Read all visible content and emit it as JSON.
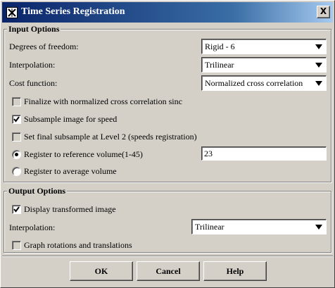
{
  "window": {
    "title": "Time Series Registration",
    "close_glyph": "X"
  },
  "input_options": {
    "title": "Input Options",
    "dof": {
      "label": "Degrees of freedom:",
      "value": "Rigid - 6"
    },
    "interpolation": {
      "label": "Interpolation:",
      "value": "Trilinear"
    },
    "cost": {
      "label": "Cost function:",
      "value": "Normalized cross correlation"
    },
    "finalize": {
      "label": "Finalize with normalized cross correlation sinc",
      "checked": false,
      "enabled": false
    },
    "subsample": {
      "label": "Subsample image for speed",
      "checked": true
    },
    "final_subsample": {
      "label": "Set final subsample at Level 2 (speeds registration)",
      "checked": false,
      "enabled": false
    },
    "register_reference": {
      "label": "Register to reference volume(1-45)",
      "selected": true,
      "value": "23"
    },
    "register_average": {
      "label": "Register to average volume",
      "selected": false
    }
  },
  "output_options": {
    "title": "Output Options",
    "display_transformed": {
      "label": "Display transformed image",
      "checked": true
    },
    "interpolation": {
      "label": "Interpolation:",
      "value": "Trilinear"
    },
    "graph": {
      "label": "Graph rotations and translations",
      "checked": false,
      "enabled": false
    }
  },
  "buttons": {
    "ok": "OK",
    "cancel": "Cancel",
    "help": "Help"
  },
  "icons": {
    "window_icon": "window-app-icon",
    "dropdown": "chevron-down-icon",
    "check": "checkmark-icon",
    "radio": "radio-dot-icon"
  },
  "colors": {
    "dialog_bg": "#d4d0c8",
    "titlebar_start": "#0a246a",
    "titlebar_end": "#a6caf0",
    "title_text": "#ffffff"
  }
}
